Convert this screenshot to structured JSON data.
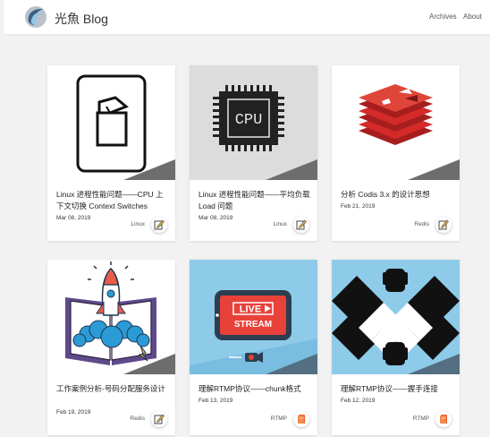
{
  "header": {
    "brand": "光魚 Blog",
    "nav": [
      "Archives",
      "About"
    ]
  },
  "colors": {
    "background": "#f2f2f2",
    "card": "#ffffff",
    "redis_red": "#d42a2a",
    "rocket_blue": "#2b9bd6",
    "live_red": "#e8413a",
    "sky_blue": "#7ec3e6",
    "rtmp_orange": "#e85a23"
  },
  "cards": [
    {
      "title": "Linux 进程性能问题——CPU 上下文切换 Context Switches",
      "date": "Mar 08, 2019",
      "tag": "Linux",
      "cover_icon": "switch-icon",
      "action_icon": "pencil-icon"
    },
    {
      "title": "Linux 进程性能问题——平均负载 Load 问题",
      "date": "Mar 08, 2019",
      "tag": "Linux",
      "cover_icon": "cpu-chip-icon",
      "cover_text": "CPU",
      "action_icon": "pencil-icon"
    },
    {
      "title": "分析 Codis 3.x 的设计思想",
      "date": "Feb 21, 2019",
      "tag": "Redis",
      "cover_icon": "redis-logo-icon",
      "action_icon": "pencil-icon"
    },
    {
      "title": "工作案例分析-号码分配服务设计",
      "date": "Feb 19, 2019",
      "tag": "Redis",
      "cover_icon": "rocket-book-icon",
      "action_icon": "pencil-icon"
    },
    {
      "title": "理解RTMP协议——chunk格式",
      "date": "Feb 13, 2019",
      "tag": "RTMP",
      "cover_icon": "live-stream-icon",
      "cover_text_1": "LIVE",
      "cover_text_2": "STREAM",
      "action_icon": "book-icon"
    },
    {
      "title": "理解RTMP协议——握手连接",
      "date": "Feb 12, 2019",
      "tag": "RTMP",
      "cover_icon": "handshake-icon",
      "action_icon": "book-icon"
    }
  ]
}
